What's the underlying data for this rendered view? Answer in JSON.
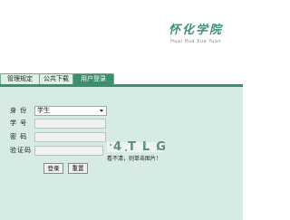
{
  "header": {
    "title": "怀化学院",
    "subtitle": "Huai Hua Xue Yuan"
  },
  "tabs": [
    {
      "label": "管理规定"
    },
    {
      "label": "公共下载"
    },
    {
      "label": "用户登录"
    }
  ],
  "form": {
    "identity_label": "身  份",
    "identity_value": "学生",
    "student_id_label": "学  号",
    "password_label": "密  码",
    "captcha_label": "验证码",
    "captcha_text": "4TLG",
    "captcha_hint": "看不清，则单击图片！",
    "login_label": "登录",
    "reset_label": "重置"
  },
  "colors": {
    "accent": "#3e8f6e",
    "panel_bg": "#d6ebe4",
    "title": "#3f8f79"
  }
}
